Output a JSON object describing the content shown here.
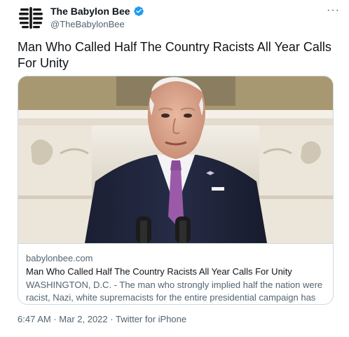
{
  "account": {
    "name": "The Babylon Bee",
    "handle": "@TheBabylonBee",
    "avatar_icon": "babylon-bee-logo",
    "verified_icon": "verified-badge-icon",
    "more_icon": "more-options-icon",
    "more_glyph": "···"
  },
  "tweet": {
    "text": "Man Who Called Half The Country Racists All Year Calls For Unity"
  },
  "card": {
    "domain": "babylonbee.com",
    "title": "Man Who Called Half The Country Racists All Year Calls For Unity",
    "description": "WASHINGTON, D.C. - The man who strongly implied half the nation were racist, Nazi, white supremacists for the entire presidential campaign has called for the…"
  },
  "meta": {
    "time": "6:47 AM",
    "separator": " · ",
    "date": "Mar 2, 2022",
    "source": "Twitter for iPhone"
  },
  "colors": {
    "verified": "#1d9bf0",
    "secondary_text": "#536471",
    "primary_text": "#0f1419",
    "border": "#cfd9de"
  }
}
